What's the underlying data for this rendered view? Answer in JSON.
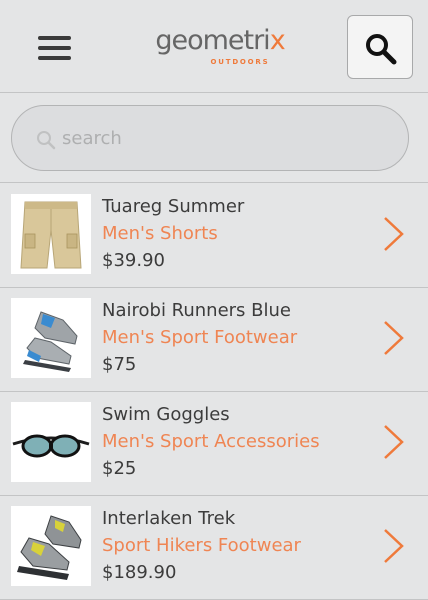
{
  "header": {
    "logo_main": "geometri",
    "logo_x": "x",
    "logo_sub": "OUTDOORS",
    "menu_icon": "hamburger-menu-icon",
    "search_icon": "search-icon"
  },
  "search": {
    "placeholder": "search",
    "value": ""
  },
  "products": [
    {
      "name": "Tuareg Summer",
      "category": "Men's Shorts",
      "price": "$39.90",
      "image": "shorts"
    },
    {
      "name": "Nairobi Runners Blue",
      "category": "Men's Sport Footwear",
      "price": "$75",
      "image": "running-shoes"
    },
    {
      "name": "Swim Goggles",
      "category": "Men's Sport Accessories",
      "price": "$25",
      "image": "swim-goggles"
    },
    {
      "name": "Interlaken Trek",
      "category": "Sport Hikers Footwear",
      "price": "$189.90",
      "image": "hiking-shoes"
    }
  ],
  "colors": {
    "accent": "#ef7a3b",
    "background": "#e4e5e6",
    "text": "#3c3c3c"
  }
}
